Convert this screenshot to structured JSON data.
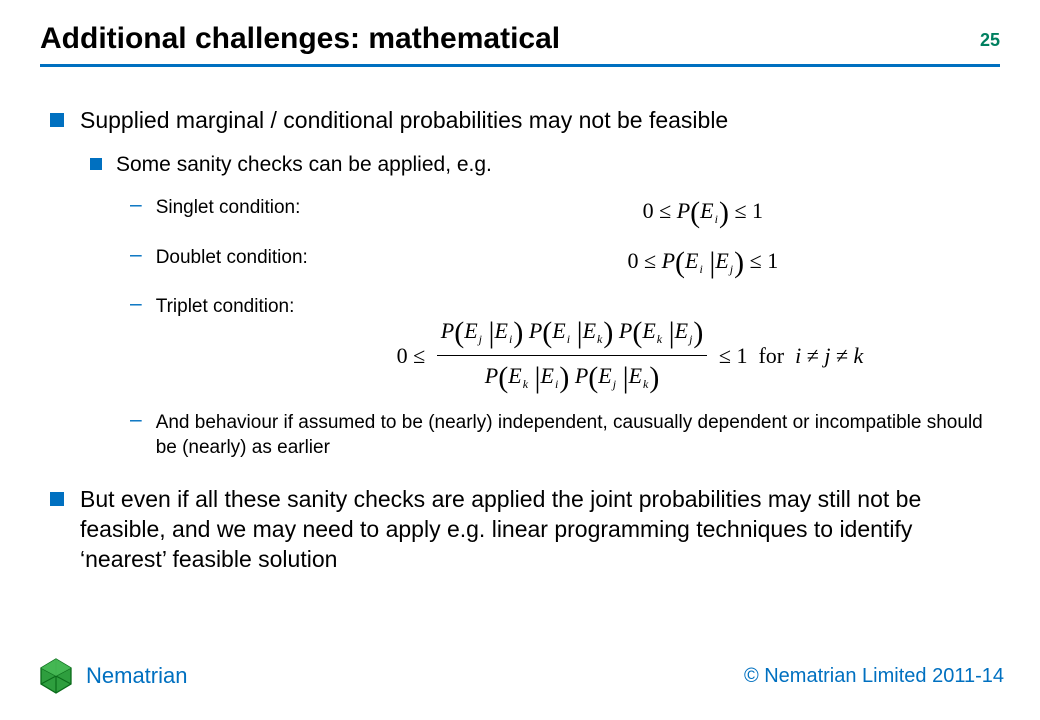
{
  "page_number": "25",
  "title": "Additional challenges: mathematical",
  "bullets": {
    "b1": "Supplied marginal / conditional probabilities may not be feasible",
    "b1_1": "Some sanity checks can be applied, e.g.",
    "singlet_label": "Singlet condition:",
    "doublet_label": "Doublet condition:",
    "triplet_label": "Triplet condition:",
    "behaviour": "And behaviour if assumed to be (nearly) independent, causually dependent or incompatible should be (nearly) as earlier",
    "b2": "But even if all these sanity checks are applied the joint probabilities may still not be feasible, and we may need to apply e.g. linear programming techniques to identify ‘nearest’ feasible solution"
  },
  "math": {
    "singlet": "0 ≤ P(E_i) ≤ 1",
    "doublet": "0 ≤ P(E_i | E_j) ≤ 1",
    "triplet_numerator": "P(E_j | E_i) P(E_i | E_k) P(E_k | E_j)",
    "triplet_denominator": "P(E_k | E_i) P(E_j | E_k)",
    "triplet_bounds_left": "0 ≤",
    "triplet_bounds_right": "≤ 1  for  i ≠ j ≠ k"
  },
  "footer": {
    "brand": "Nematrian",
    "copyright": "© Nematrian Limited 2011-14"
  },
  "icons": {
    "logo": "nematrian-logo"
  },
  "colors": {
    "accent": "#0070c0",
    "page_num": "#008060"
  }
}
